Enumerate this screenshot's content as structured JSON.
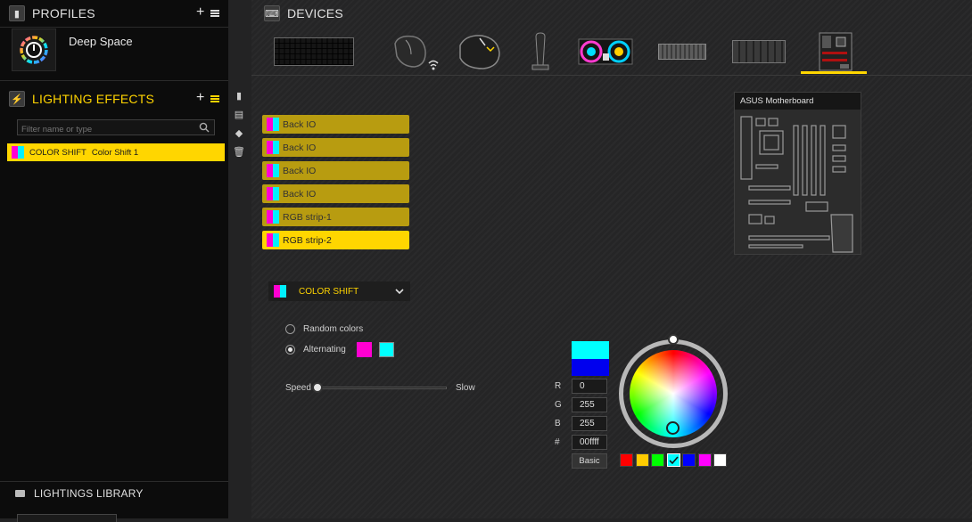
{
  "profiles": {
    "title": "PROFILES",
    "plus": "+",
    "current": {
      "name": "Deep Space"
    }
  },
  "lighting_effects": {
    "title": "LIGHTING EFFECTS",
    "plus": "+",
    "filter_placeholder": "Filter name or type",
    "items": [
      {
        "type": "COLOR SHIFT",
        "name": "Color Shift 1",
        "colors": [
          "#ff00d2",
          "#00f0ff"
        ]
      }
    ]
  },
  "library": {
    "title": "LIGHTINGS LIBRARY"
  },
  "devices": {
    "title": "DEVICES",
    "items": [
      {
        "name": "keyboard-device"
      },
      {
        "name": "wireless-mouse-device"
      },
      {
        "name": "mouse-device"
      },
      {
        "name": "headset-stand-device"
      },
      {
        "name": "cooler-device"
      },
      {
        "name": "memory-device"
      },
      {
        "name": "lighting-controller-device"
      },
      {
        "name": "motherboard-device"
      }
    ],
    "selected_index": 7
  },
  "motherboard": {
    "title": "ASUS Motherboard"
  },
  "led_channels": [
    {
      "label": "Back IO",
      "active": false
    },
    {
      "label": "Back IO",
      "active": false
    },
    {
      "label": "Back IO",
      "active": false
    },
    {
      "label": "Back IO",
      "active": false
    },
    {
      "label": "RGB strip-1",
      "active": false
    },
    {
      "label": "RGB strip-2",
      "active": true
    }
  ],
  "effect": {
    "selected": "COLOR SHIFT",
    "colors": [
      "#ff00d2",
      "#00f0ff"
    ],
    "random_colors_label": "Random colors",
    "alternating_label": "Alternating",
    "alternating_colors": [
      "#ff00d2",
      "#00ffff"
    ],
    "speed_label": "Speed",
    "slow_label": "Slow",
    "speed_fraction": 0.0
  },
  "color_picker": {
    "preview_top": "#00ffff",
    "preview_bottom": "#0000ee",
    "r_label": "R",
    "g_label": "G",
    "b_label": "B",
    "hex_label": "#",
    "r": "0",
    "g": "255",
    "b": "255",
    "hex": "00ffff",
    "basic_label": "Basic",
    "palette": [
      "#ff0000",
      "#ffcc00",
      "#00ff00",
      "#00ffff",
      "#0000ff",
      "#ff00ff",
      "#ffffff"
    ],
    "palette_selected": 3
  }
}
